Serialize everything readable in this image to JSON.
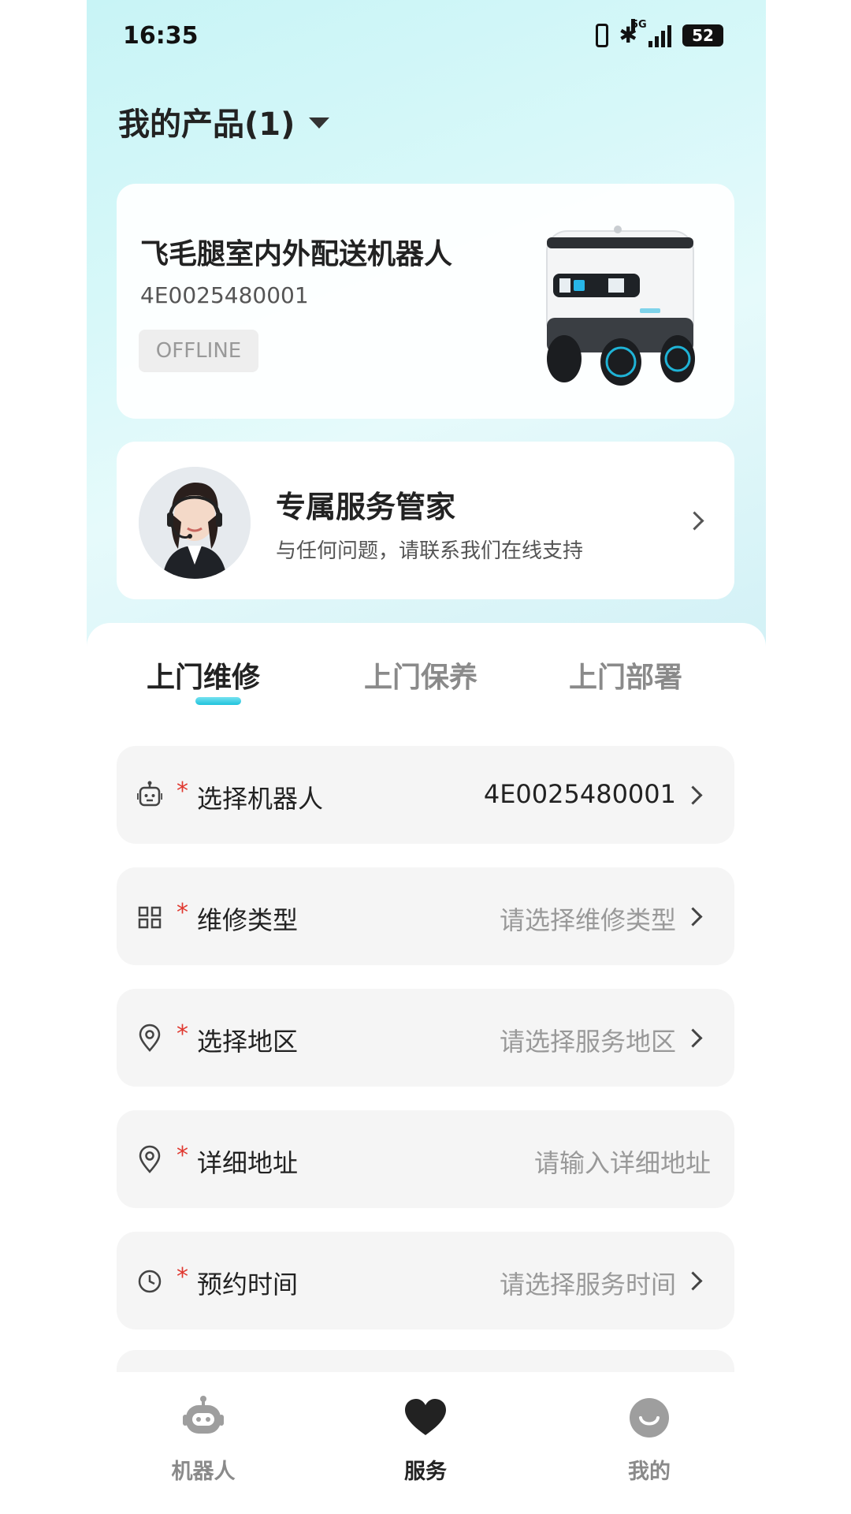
{
  "status_bar": {
    "time": "16:35",
    "network": "5G",
    "battery": "52",
    "icons": [
      "vibrate-icon",
      "bluetooth-icon",
      "signal-icon",
      "battery-icon"
    ]
  },
  "header": {
    "title": "我的产品(1)",
    "dropdown_icon": "caret-down-icon"
  },
  "product_card": {
    "name": "飞毛腿室内外配送机器人",
    "serial": "4E0025480001",
    "status": "OFFLINE"
  },
  "service_card": {
    "title": "专属服务管家",
    "subtitle": "与任何问题，请联系我们在线支持"
  },
  "tabs": [
    {
      "label": "上门维修",
      "active": true
    },
    {
      "label": "上门保养",
      "active": false
    },
    {
      "label": "上门部署",
      "active": false
    }
  ],
  "form": {
    "required_mark": "*",
    "rows": [
      {
        "icon": "robot-icon",
        "label": "选择机器人",
        "value": "4E0025480001",
        "placeholder": false,
        "arrow": true
      },
      {
        "icon": "grid-icon",
        "label": "维修类型",
        "value": "请选择维修类型",
        "placeholder": true,
        "arrow": true
      },
      {
        "icon": "location-icon",
        "label": "选择地区",
        "value": "请选择服务地区",
        "placeholder": true,
        "arrow": true
      },
      {
        "icon": "location-icon",
        "label": "详细地址",
        "value": "请输入详细地址",
        "placeholder": true,
        "arrow": false
      },
      {
        "icon": "clock-icon",
        "label": "预约时间",
        "value": "请选择服务时间",
        "placeholder": true,
        "arrow": true
      }
    ]
  },
  "bottom_nav": [
    {
      "icon": "robot-icon",
      "label": "机器人",
      "active": false
    },
    {
      "icon": "heart-icon",
      "label": "服务",
      "active": true
    },
    {
      "icon": "smile-icon",
      "label": "我的",
      "active": false
    }
  ],
  "colors": {
    "accent": "#1fc2dc",
    "required": "#e0382f",
    "placeholder": "#999999",
    "inactive_tab": "#8a8a8a"
  }
}
